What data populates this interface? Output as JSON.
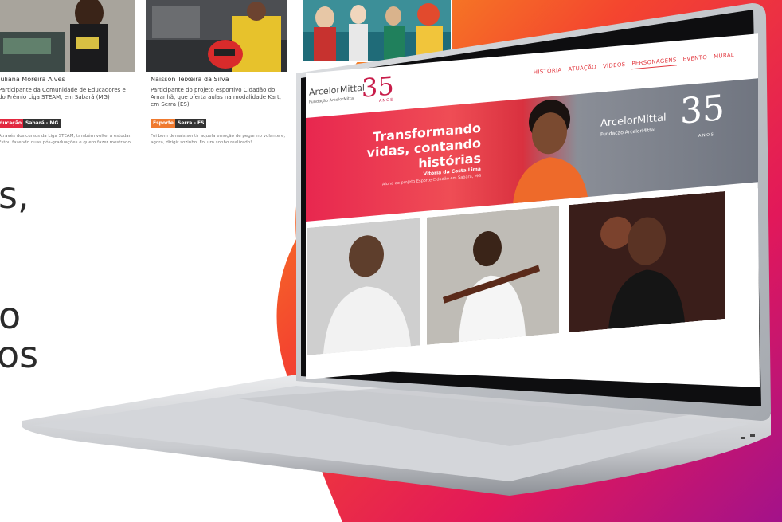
{
  "side_text": {
    "line1": "s,",
    "line2": "o",
    "line3": "os"
  },
  "cards": [
    {
      "name": "Juliana Moreira Alves",
      "description": "Participante da Comunidade de Educadores e do Prêmio Liga STEAM, em Sabará (MG)",
      "tags": [
        "Educação",
        "Sabará - MG"
      ],
      "quote": "Através dos cursos da Liga STEAM, também voltei a estudar. Estou fazendo duas pós-graduações e quero fazer mestrado."
    },
    {
      "name": "Naisson Teixeira da Silva",
      "description": "Participante do projeto esportivo Cidadão do Amanhã, que oferta aulas na modalidade Kart, em Serra (ES)",
      "tags": [
        "Esporte",
        "Serra - ES"
      ],
      "quote": "Foi bom demais sentir aquela emoção de pegar no volante e, agora, dirigir sozinho. Foi um sonho realizado!"
    }
  ],
  "site": {
    "brand": "ArcelorMittal",
    "brand_sub": "Fundação ArcelorMittal",
    "number": "35",
    "anos": "ANOS",
    "menu": [
      "HISTÓRIA",
      "ATUAÇÃO",
      "VÍDEOS",
      "PERSONAGENS",
      "EVENTO",
      "MURAL"
    ],
    "active_menu": "PERSONAGENS",
    "hero": {
      "title": "Transformando vidas, contando histórias",
      "person_name": "Vitória da Costa Lima",
      "person_desc": "Aluna do projeto Esporte Cidadão em Sabará, MG",
      "logo": "ArcelorMittal",
      "logo_sub": "Fundação ArcelorMittal",
      "number": "35",
      "anos": "ANOS"
    }
  },
  "colors": {
    "accent_red": "#e2383f",
    "accent_crimson": "#c81d4a",
    "tag_red": "#e2283f",
    "tag_orange": "#ef7a2f",
    "tag_dark": "#333333"
  }
}
